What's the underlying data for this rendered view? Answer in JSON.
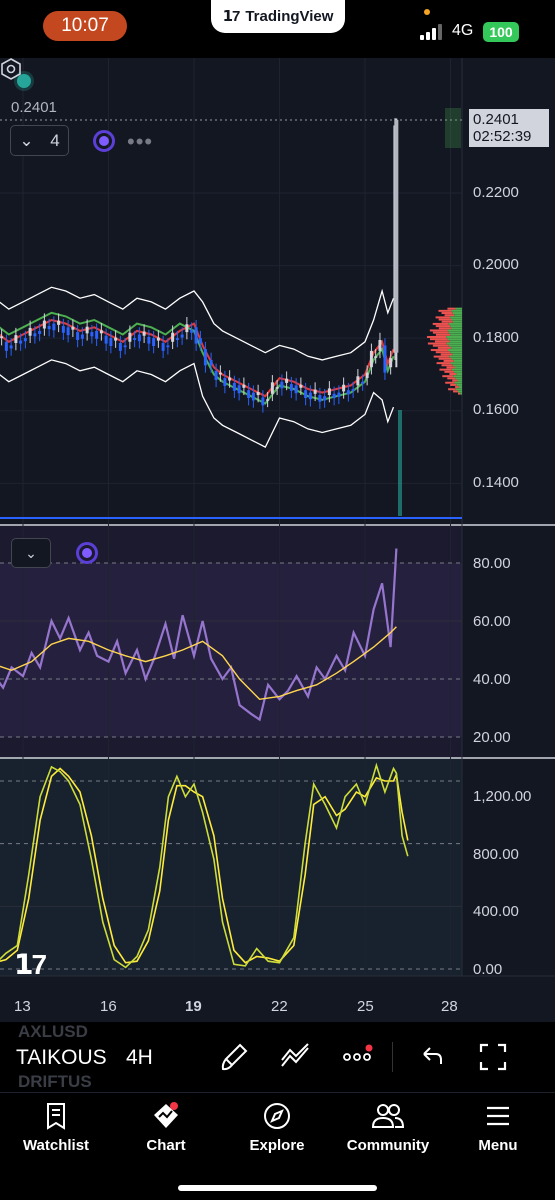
{
  "status_bar": {
    "time": "10:07",
    "app_banner": "TradingView",
    "network": "4G",
    "battery": "100"
  },
  "chart": {
    "last_price": "0.2401",
    "legend_count": "4",
    "price_tag": {
      "price": "0.2401",
      "countdown": "02:52:39"
    },
    "price_axis": [
      "0.2200",
      "0.2000",
      "0.1800",
      "0.1600",
      "0.1400"
    ],
    "rsi_axis": [
      "80.00",
      "60.00",
      "40.00",
      "20.00"
    ],
    "osc_axis": [
      "1,200.00",
      "800.00",
      "400.00",
      "0.00"
    ],
    "time_axis": [
      "13",
      "16",
      "19",
      "22",
      "25",
      "28"
    ],
    "colors": {
      "background": "#131722",
      "bollinger": "#ffffff",
      "ema_red": "#e53935",
      "ema_green": "#4caf50",
      "candle_blue": "#2962ff",
      "candle_white": "#d1d4dc",
      "rsi": "#9575cd",
      "rsi_ma": "#ffd54f",
      "stoch_k": "#cddc39",
      "stoch_d": "#ffeb3b",
      "volume_profile_up": "#4caf50",
      "volume_profile_down": "#ef5350"
    }
  },
  "chart_data": [
    {
      "type": "line",
      "name": "price",
      "x_ticks": [
        "13",
        "16",
        "19",
        "22",
        "25",
        "28"
      ],
      "y_ticks": [
        0.22,
        0.2,
        0.18,
        0.16,
        0.14
      ],
      "ylim": [
        0.13,
        0.245
      ],
      "last_value": 0.2401,
      "points": [
        [
          12.0,
          0.181
        ],
        [
          12.5,
          0.178
        ],
        [
          13.0,
          0.18
        ],
        [
          13.5,
          0.182
        ],
        [
          14.0,
          0.184
        ],
        [
          14.5,
          0.183
        ],
        [
          15.0,
          0.181
        ],
        [
          15.5,
          0.182
        ],
        [
          16.0,
          0.18
        ],
        [
          16.5,
          0.178
        ],
        [
          17.0,
          0.181
        ],
        [
          17.5,
          0.18
        ],
        [
          18.0,
          0.178
        ],
        [
          18.5,
          0.181
        ],
        [
          19.0,
          0.183
        ],
        [
          19.3,
          0.177
        ],
        [
          19.7,
          0.171
        ],
        [
          20.0,
          0.169
        ],
        [
          20.5,
          0.167
        ],
        [
          21.0,
          0.165
        ],
        [
          21.5,
          0.163
        ],
        [
          22.0,
          0.168
        ],
        [
          22.5,
          0.167
        ],
        [
          23.0,
          0.165
        ],
        [
          23.5,
          0.164
        ],
        [
          24.0,
          0.165
        ],
        [
          24.5,
          0.166
        ],
        [
          25.0,
          0.169
        ],
        [
          25.3,
          0.175
        ],
        [
          25.6,
          0.178
        ],
        [
          25.8,
          0.172
        ],
        [
          26.0,
          0.176
        ],
        [
          26.1,
          0.2401
        ]
      ]
    },
    {
      "type": "line",
      "name": "RSI",
      "y_ticks": [
        80,
        60,
        40,
        20
      ],
      "ylim": [
        15,
        88
      ],
      "series": [
        {
          "name": "RSI",
          "values": [
            [
              12.0,
              41
            ],
            [
              12.3,
              37
            ],
            [
              12.6,
              44
            ],
            [
              13.0,
              41
            ],
            [
              13.3,
              49
            ],
            [
              13.6,
              44
            ],
            [
              14.0,
              60
            ],
            [
              14.3,
              54
            ],
            [
              14.6,
              61
            ],
            [
              15.0,
              50
            ],
            [
              15.3,
              56
            ],
            [
              15.6,
              48
            ],
            [
              16.0,
              46
            ],
            [
              16.3,
              53
            ],
            [
              16.6,
              42
            ],
            [
              17.0,
              50
            ],
            [
              17.3,
              40
            ],
            [
              17.6,
              47
            ],
            [
              18.0,
              59
            ],
            [
              18.3,
              47
            ],
            [
              18.6,
              62
            ],
            [
              19.0,
              48
            ],
            [
              19.3,
              60
            ],
            [
              19.6,
              47
            ],
            [
              20.0,
              40
            ],
            [
              20.3,
              44
            ],
            [
              20.6,
              31
            ],
            [
              21.0,
              28
            ],
            [
              21.3,
              26
            ],
            [
              21.6,
              38
            ],
            [
              22.0,
              33
            ],
            [
              22.3,
              36
            ],
            [
              22.6,
              41
            ],
            [
              23.0,
              34
            ],
            [
              23.3,
              44
            ],
            [
              23.6,
              40
            ],
            [
              24.0,
              48
            ],
            [
              24.3,
              43
            ],
            [
              24.6,
              56
            ],
            [
              25.0,
              48
            ],
            [
              25.3,
              64
            ],
            [
              25.6,
              73
            ],
            [
              25.9,
              51
            ],
            [
              26.1,
              85
            ]
          ]
        },
        {
          "name": "RSI-based MA",
          "values": [
            [
              12.0,
              45
            ],
            [
              12.6,
              43
            ],
            [
              13.3,
              46
            ],
            [
              14.0,
              52
            ],
            [
              14.6,
              54
            ],
            [
              15.3,
              53
            ],
            [
              16.0,
              50
            ],
            [
              16.6,
              48
            ],
            [
              17.3,
              46
            ],
            [
              18.0,
              48
            ],
            [
              18.6,
              50
            ],
            [
              19.3,
              53
            ],
            [
              20.0,
              48
            ],
            [
              20.6,
              40
            ],
            [
              21.3,
              33
            ],
            [
              22.0,
              34
            ],
            [
              22.6,
              36
            ],
            [
              23.3,
              38
            ],
            [
              24.0,
              42
            ],
            [
              24.6,
              46
            ],
            [
              25.3,
              51
            ],
            [
              25.9,
              56
            ],
            [
              26.1,
              58
            ]
          ]
        }
      ]
    },
    {
      "type": "line",
      "name": "oscillator",
      "y_ticks": [
        1200,
        800,
        400,
        0
      ],
      "ylim": [
        -50,
        1340
      ],
      "series": [
        {
          "name": "K",
          "values": [
            [
              12.0,
              30
            ],
            [
              12.4,
              100
            ],
            [
              12.8,
              150
            ],
            [
              13.2,
              600
            ],
            [
              13.6,
              1100
            ],
            [
              14.0,
              1290
            ],
            [
              14.3,
              1260
            ],
            [
              14.6,
              1200
            ],
            [
              15.0,
              1050
            ],
            [
              15.4,
              700
            ],
            [
              15.8,
              300
            ],
            [
              16.2,
              60
            ],
            [
              16.6,
              10
            ],
            [
              17.0,
              80
            ],
            [
              17.4,
              250
            ],
            [
              17.8,
              650
            ],
            [
              18.1,
              1100
            ],
            [
              18.4,
              1230
            ],
            [
              18.7,
              1100
            ],
            [
              19.0,
              1180
            ],
            [
              19.3,
              1000
            ],
            [
              19.7,
              700
            ],
            [
              20.0,
              300
            ],
            [
              20.4,
              30
            ],
            [
              20.8,
              20
            ],
            [
              21.2,
              130
            ],
            [
              21.6,
              50
            ],
            [
              22.0,
              40
            ],
            [
              22.5,
              200
            ],
            [
              22.9,
              800
            ],
            [
              23.2,
              1180
            ],
            [
              23.6,
              1050
            ],
            [
              24.0,
              900
            ],
            [
              24.3,
              1100
            ],
            [
              24.7,
              1180
            ],
            [
              25.0,
              1050
            ],
            [
              25.4,
              1300
            ],
            [
              25.7,
              1130
            ],
            [
              26.0,
              1280
            ],
            [
              26.1,
              1250
            ],
            [
              26.3,
              850
            ],
            [
              26.5,
              720
            ]
          ]
        },
        {
          "name": "D",
          "values": [
            [
              12.0,
              40
            ],
            [
              12.4,
              60
            ],
            [
              12.8,
              120
            ],
            [
              13.2,
              450
            ],
            [
              13.6,
              950
            ],
            [
              14.0,
              1230
            ],
            [
              14.3,
              1280
            ],
            [
              14.6,
              1230
            ],
            [
              15.0,
              1130
            ],
            [
              15.4,
              850
            ],
            [
              15.8,
              450
            ],
            [
              16.2,
              150
            ],
            [
              16.6,
              40
            ],
            [
              17.0,
              50
            ],
            [
              17.4,
              180
            ],
            [
              17.8,
              500
            ],
            [
              18.1,
              950
            ],
            [
              18.4,
              1170
            ],
            [
              18.7,
              1170
            ],
            [
              19.0,
              1130
            ],
            [
              19.3,
              1100
            ],
            [
              19.7,
              850
            ],
            [
              20.0,
              450
            ],
            [
              20.4,
              120
            ],
            [
              20.8,
              40
            ],
            [
              21.2,
              80
            ],
            [
              21.6,
              70
            ],
            [
              22.0,
              50
            ],
            [
              22.5,
              150
            ],
            [
              22.9,
              600
            ],
            [
              23.2,
              1050
            ],
            [
              23.6,
              1100
            ],
            [
              24.0,
              980
            ],
            [
              24.3,
              1020
            ],
            [
              24.7,
              1130
            ],
            [
              25.0,
              1100
            ],
            [
              25.4,
              1220
            ],
            [
              25.7,
              1200
            ],
            [
              26.0,
              1200
            ],
            [
              26.1,
              1240
            ],
            [
              26.3,
              1000
            ],
            [
              26.5,
              820
            ]
          ]
        }
      ]
    }
  ],
  "toolbar": {
    "ghost_top": "AXLUSD",
    "ghost_bottom": "DRIFTUS",
    "symbol": "TAIKOUS",
    "interval": "4H"
  },
  "tabs": [
    {
      "label": "Watchlist",
      "icon": "bookmark-icon"
    },
    {
      "label": "Chart",
      "icon": "chart-diamond-icon"
    },
    {
      "label": "Explore",
      "icon": "compass-icon"
    },
    {
      "label": "Community",
      "icon": "people-icon"
    },
    {
      "label": "Menu",
      "icon": "hamburger-icon"
    }
  ]
}
